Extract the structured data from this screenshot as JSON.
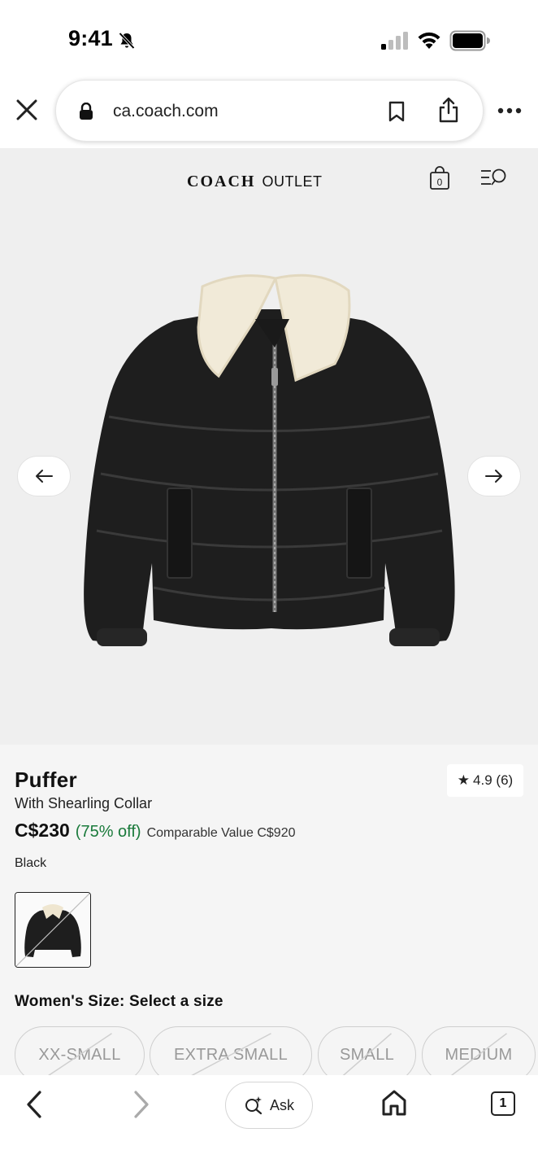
{
  "status_bar": {
    "time": "9:41"
  },
  "browser": {
    "url": "ca.coach.com"
  },
  "header": {
    "logo_brand": "COACH",
    "logo_suffix": "OUTLET",
    "bag_count": "0"
  },
  "product": {
    "title": "Puffer",
    "subtitle": "With Shearling Collar",
    "rating": "4.9 (6)",
    "price": "C$230",
    "discount": "(75% off)",
    "comparable": "Comparable Value C$920",
    "color": "Black",
    "size_label": "Women's Size: Select a size",
    "sizes": [
      "XX-SMALL",
      "EXTRA SMALL",
      "SMALL",
      "MEDIUM"
    ]
  },
  "toolbar": {
    "ask_label": "Ask",
    "tab_count": "1"
  },
  "colors": {
    "accent_discount": "#1a7a3b",
    "hero_bg": "#efefef",
    "info_bg": "#f5f5f5"
  }
}
